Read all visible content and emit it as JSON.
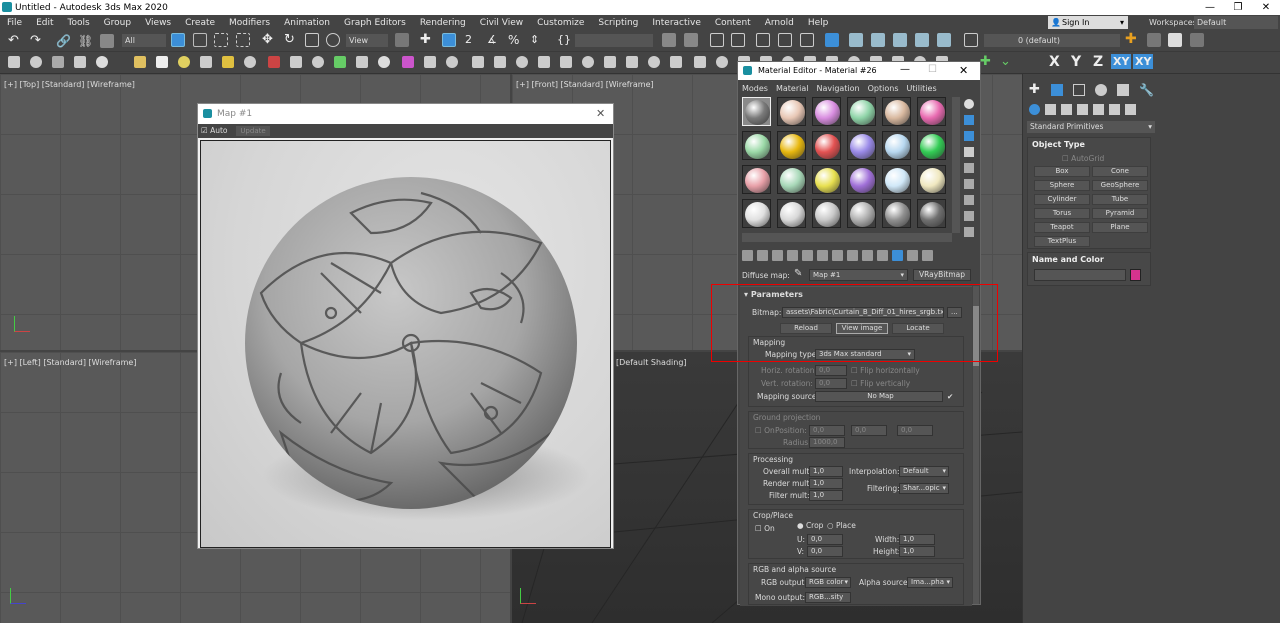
{
  "title": "Untitled - Autodesk 3ds Max 2020",
  "menu": [
    "File",
    "Edit",
    "Tools",
    "Group",
    "Views",
    "Create",
    "Modifiers",
    "Animation",
    "Graph Editors",
    "Rendering",
    "Civil View",
    "Customize",
    "Scripting",
    "Interactive",
    "Content",
    "Arnold",
    "Help"
  ],
  "account": {
    "sign_in": "Sign In",
    "workspaces_label": "Workspaces:",
    "workspace": "Default"
  },
  "toolbar": {
    "filter": "All",
    "refcoord": "View",
    "layer": "0 (default)"
  },
  "axes": {
    "x": "X",
    "y": "Y",
    "z": "Z",
    "xy": "XY"
  },
  "viewports": {
    "top": "[+] [Top] [Standard] [Wireframe]",
    "front": "[+] [Front] [Standard] [Wireframe]",
    "left": "[+] [Left] [Standard] [Wireframe]",
    "persp": "[Default Shading]"
  },
  "command_panel": {
    "category": "Standard Primitives",
    "object_type_title": "Object Type",
    "autogrid": "AutoGrid",
    "buttons": [
      "Box",
      "Cone",
      "Sphere",
      "GeoSphere",
      "Cylinder",
      "Tube",
      "Torus",
      "Pyramid",
      "Teapot",
      "Plane",
      "TextPlus"
    ],
    "name_color_title": "Name and Color",
    "swatch_color": "#d6338e"
  },
  "map_window": {
    "title": "Map #1",
    "auto": "Auto",
    "update": "Update"
  },
  "material_editor": {
    "title": "Material Editor - Material #26",
    "menu": [
      "Modes",
      "Material",
      "Navigation",
      "Options",
      "Utilities"
    ],
    "swatches": [
      "#7a7a7a",
      "#e8c7b5",
      "#d98ee0",
      "#8fd4a8",
      "#d9b9a0",
      "#e86ab0",
      "#9bd9a7",
      "#e8b80f",
      "#e35252",
      "#9a8ae8",
      "#b8d8f0",
      "#33cc55",
      "#e8a0a8",
      "#a8d8b8",
      "#e8e050",
      "#a070d8",
      "#d0e8f8",
      "#f0e8c0",
      "#e0e0e0",
      "#d8d8d8",
      "#c8c8c8",
      "#b0b0b0",
      "#909090",
      "#707070"
    ],
    "diffuse_label": "Diffuse map:",
    "map_name": "Map #1",
    "map_type": "VRayBitmap",
    "parameters": "Parameters",
    "bitmap_label": "Bitmap:",
    "bitmap_path": "assets\\Fabric\\Curtain_B_Diff_01_hires_srgb.tx",
    "ellipsis": "...",
    "reload": "Reload",
    "view_image": "View image",
    "locate": "Locate",
    "mapping": "Mapping",
    "mapping_type_label": "Mapping type:",
    "mapping_type": "3ds Max standard",
    "horiz_rot": "Horiz. rotation:",
    "vert_rot": "Vert. rotation:",
    "zero": "0,0",
    "flip_h": "Flip horizontally",
    "flip_v": "Flip vertically",
    "mapping_source": "Mapping source:",
    "no_map": "No Map",
    "ground_projection": "Ground projection",
    "on": "On",
    "position": "Position:",
    "radius": "Radius:",
    "radius_val": "1000,0",
    "processing": "Processing",
    "overall_mult": "Overall mult:",
    "render_mult": "Render mult:",
    "filter_mult": "Filter mult:",
    "one": "1,0",
    "interpolation": "Interpolation:",
    "interp_val": "Default",
    "filtering": "Filtering:",
    "filter_val": "Shar...opic",
    "crop_place": "Crop/Place",
    "crop": "Crop",
    "place": "Place",
    "u": "U:",
    "v": "V:",
    "width": "Width:",
    "height": "Height:",
    "rgb_alpha": "RGB and alpha source",
    "rgb_output": "RGB output:",
    "rgb_val": "RGB color",
    "alpha_source": "Alpha source:",
    "alpha_val": "Ima...pha",
    "mono_output": "Mono output:",
    "mono_val": "RGB...sity"
  }
}
